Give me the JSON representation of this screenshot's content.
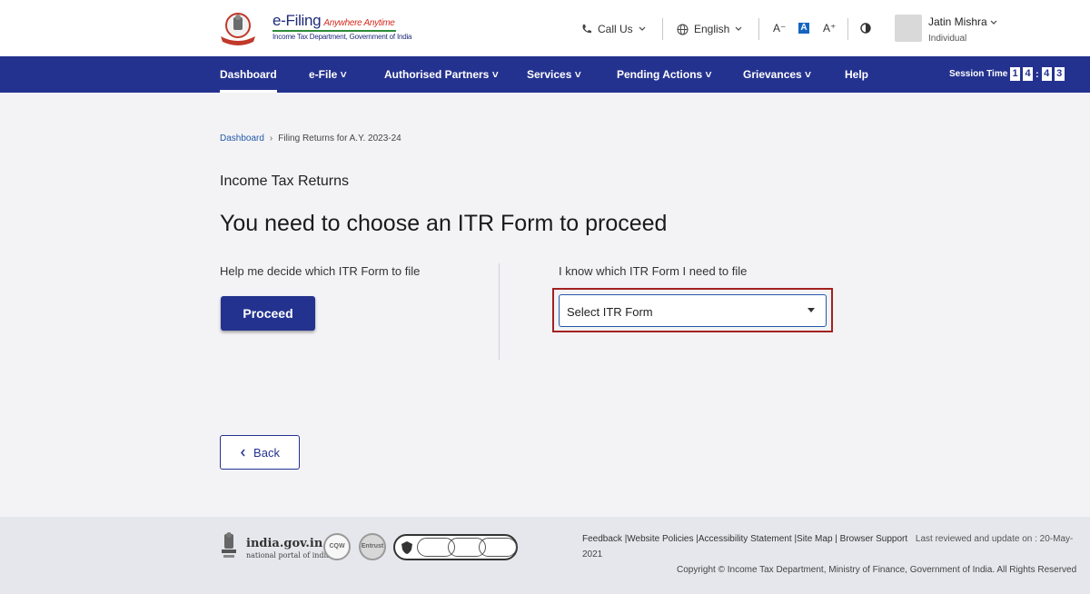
{
  "header": {
    "brand_name": "e-Filing",
    "brand_tagline": "Anywhere Anytime",
    "brand_subtitle": "Income Tax Department, Government of India",
    "call_us": "Call Us",
    "language": "English",
    "font_decrease": "A⁻",
    "font_default": "A",
    "font_increase": "A⁺",
    "user_name": "Jatin Mishra",
    "user_role": "Individual"
  },
  "nav": {
    "items": [
      {
        "label": "Dashboard"
      },
      {
        "label": "e-File ˅"
      },
      {
        "label": "Authorised Partners ˅"
      },
      {
        "label": "Services ˅"
      },
      {
        "label": "Pending Actions ˅"
      },
      {
        "label": "Grievances ˅"
      },
      {
        "label": "Help"
      }
    ],
    "session_label": "Session Time",
    "session_digits": [
      "1",
      "4",
      "4",
      "3"
    ]
  },
  "breadcrumb": {
    "home": "Dashboard",
    "separator": "›",
    "current": "Filing Returns for A.Y. 2023-24"
  },
  "main": {
    "section_label": "Income Tax Returns",
    "title": "You need to choose an ITR Form to proceed",
    "help_text": "Help me decide which ITR Form to file",
    "proceed_label": "Proceed",
    "know_text": "I know which ITR Form I need to file",
    "select_value": "Select ITR Form",
    "back_label": "Back"
  },
  "footer": {
    "gov_site": "india.gov.in",
    "gov_sub": "national portal of india",
    "badge1": "CQW",
    "badge2": "Entrust",
    "links": "Feedback |Website Policies |Accessibility Statement |Site Map | Browser Support",
    "last_reviewed": "Last reviewed and update on : 20-May-",
    "year": "2021",
    "copyright": "Copyright © Income Tax Department, Ministry of Finance, Government of India. All Rights Reserved"
  },
  "colors": {
    "nav_bg": "#24328f",
    "highlight_border": "#a32020",
    "link": "#2458a8"
  }
}
